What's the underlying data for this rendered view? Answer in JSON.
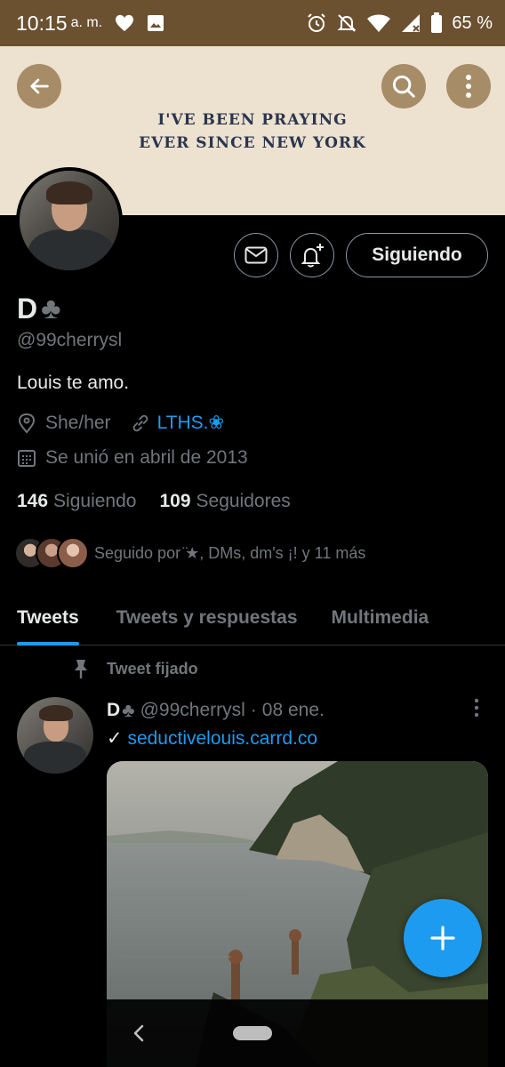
{
  "status_bar": {
    "time": "10:15",
    "ampm": "a. m.",
    "battery": "65 %"
  },
  "banner": {
    "line1": "I'VE BEEN PRAYING",
    "line2": "EVER SINCE NEW YORK"
  },
  "profile": {
    "name": "D",
    "name_symbol": "♣",
    "handle": "@99cherrysl",
    "bio": "Louis te amo.",
    "location": "She/her",
    "link": "LTHS.❀",
    "joined": "Se unió en abril de 2013",
    "following_count": "146",
    "following_label": "Siguiendo",
    "followers_count": "109",
    "followers_label": "Seguidores",
    "followed_by": "Seguido por ̈★, DMs, dm's ¡! y 11 más",
    "follow_button": "Siguiendo"
  },
  "tabs": [
    {
      "label": "Tweets",
      "active": true
    },
    {
      "label": "Tweets y respuestas",
      "active": false
    },
    {
      "label": "Multimedia",
      "active": false
    }
  ],
  "pinned_tweet": {
    "pinned_label": "Tweet fijado",
    "name": "D",
    "name_symbol": "♣",
    "handle": "@99cherrysl",
    "separator": "·",
    "date": "08 ene.",
    "text_prefix": "✓",
    "link": "seductivelouis.carrd.co"
  },
  "colors": {
    "accent": "#1d9bf0",
    "status_bar": "#6b5130",
    "banner_bg": "#ece2cf",
    "banner_text": "#2b3550"
  }
}
